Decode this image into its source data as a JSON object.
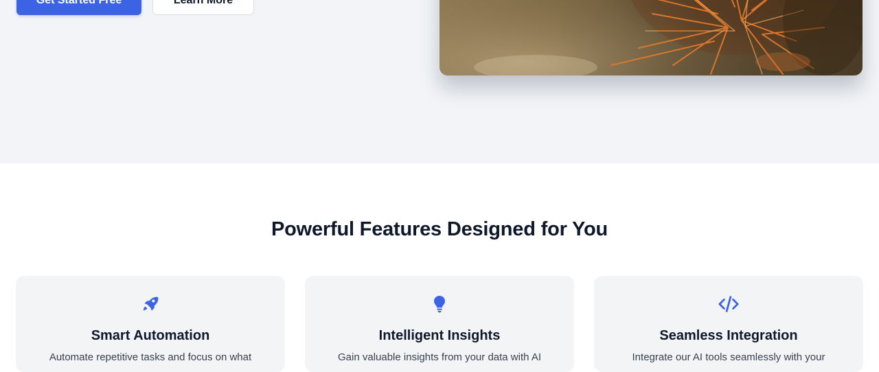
{
  "hero": {
    "primary_button": "Get Started Free",
    "secondary_button": "Learn More",
    "image_alt": "Close-up of a cactus"
  },
  "features": {
    "title": "Powerful Features Designed for You",
    "cards": [
      {
        "icon": "rocket-icon",
        "title": "Smart Automation",
        "description": "Automate repetitive tasks and focus on what"
      },
      {
        "icon": "lightbulb-icon",
        "title": "Intelligent Insights",
        "description": "Gain valuable insights from your data with AI"
      },
      {
        "icon": "code-icon",
        "title": "Seamless Integration",
        "description": "Integrate our AI tools seamlessly with your"
      }
    ]
  },
  "colors": {
    "accent": "#3b63e3",
    "hero_background": "#f2f4f7",
    "card_background": "#f3f4f6",
    "heading": "#0f172a"
  }
}
